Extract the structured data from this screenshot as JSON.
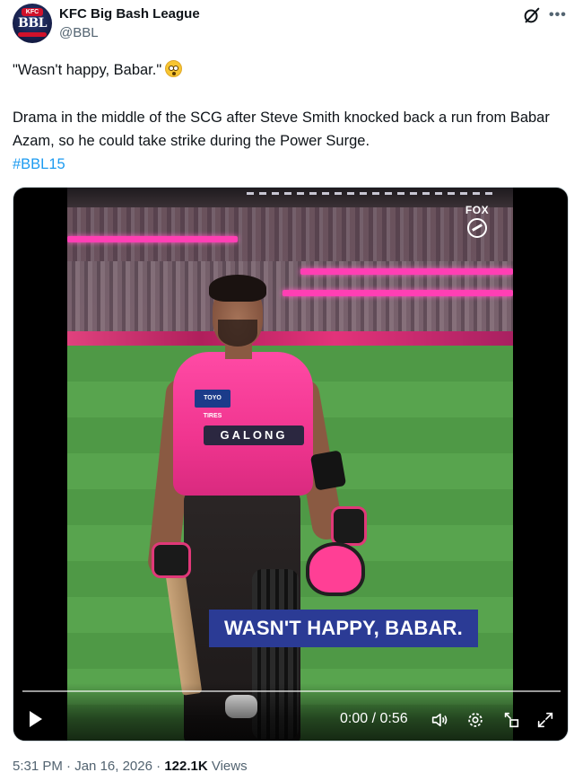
{
  "account": {
    "name": "KFC Big Bash League",
    "handle": "@BBL",
    "avatar_text_top": "KFC",
    "avatar_text_main": "BBL"
  },
  "post": {
    "line1": "\"Wasn't happy, Babar.\"",
    "line2": "Drama in the middle of the SCG after Steve Smith knocked back a run from Babar Azam, so he could take strike during the Power Surge.",
    "hashtag": "#BBL15"
  },
  "video": {
    "caption": "WASN'T HAPPY, BABAR.",
    "time": "0:00 / 0:56",
    "progress_fraction": 0,
    "broadcaster_logo": "FOX",
    "jersey_sponsor": "GALONG",
    "sleeve_sponsor": "TOYO TIRES"
  },
  "meta": {
    "time": "5:31 PM",
    "date": "Jan 16, 2026",
    "views_count": "122.1K",
    "views_label": "Views"
  },
  "icons": {
    "grok": "grok-icon",
    "more": "more-icon",
    "play": "play-icon",
    "volume": "volume-icon",
    "settings": "settings-icon",
    "pip": "pip-icon",
    "fullscreen": "fullscreen-icon"
  },
  "colors": {
    "link": "#1d9bf0",
    "text": "#0f1419",
    "secondary": "#536471",
    "caption_bg": "#2b3b95",
    "jersey_pink": "#ff4aa5"
  }
}
